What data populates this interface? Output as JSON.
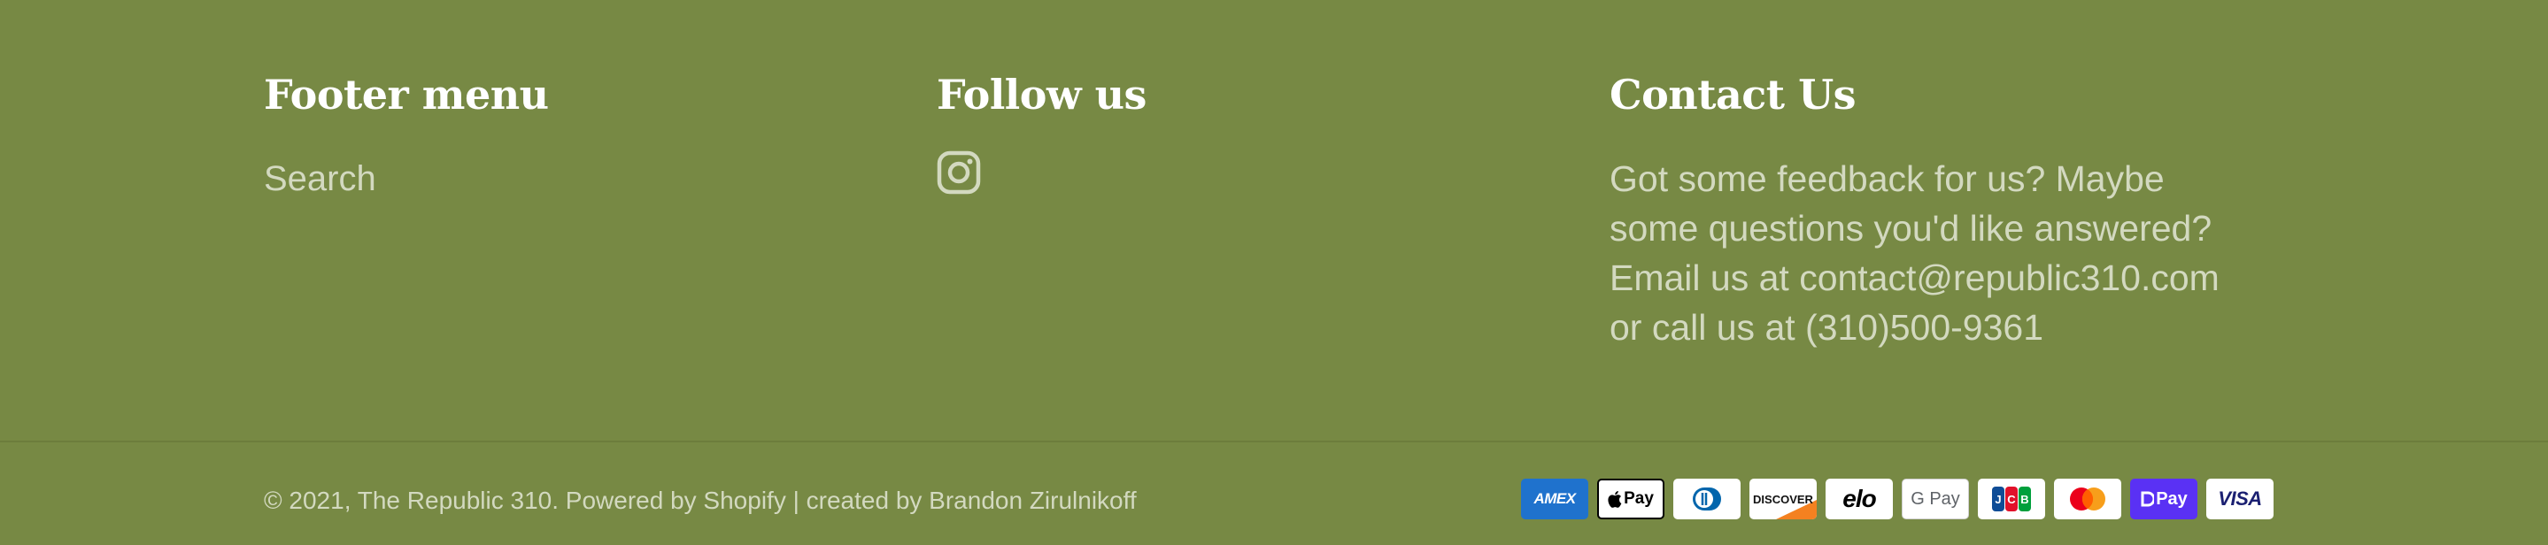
{
  "footer_menu": {
    "heading": "Footer menu",
    "links": [
      "Search"
    ]
  },
  "follow": {
    "heading": "Follow us",
    "icons": [
      "instagram-icon"
    ]
  },
  "contact": {
    "heading": "Contact Us",
    "lines": [
      "Got some feedback for us? Maybe",
      "some questions you'd like answered?",
      "Email us at contact@republic310.com",
      "or call us at (310)500-9361"
    ]
  },
  "copyright": "© 2021, The Republic 310. Powered by Shopify | created by Brandon Zirulnikoff",
  "payments": [
    {
      "name": "American Express",
      "text": "AMEX"
    },
    {
      "name": "Apple Pay",
      "text": "Pay"
    },
    {
      "name": "Diners Club",
      "text": ""
    },
    {
      "name": "Discover",
      "text": "DISCOVER"
    },
    {
      "name": "Elo",
      "text": "elo"
    },
    {
      "name": "Google Pay",
      "text": "G Pay"
    },
    {
      "name": "JCB",
      "text": ""
    },
    {
      "name": "Mastercard",
      "text": ""
    },
    {
      "name": "Shop Pay",
      "text": "Pay"
    },
    {
      "name": "Visa",
      "text": "VISA"
    }
  ],
  "colors": {
    "background": "#778944",
    "heading": "#ffffff",
    "body_text": "#d3d9c0",
    "divider": "#6c7d3c"
  }
}
